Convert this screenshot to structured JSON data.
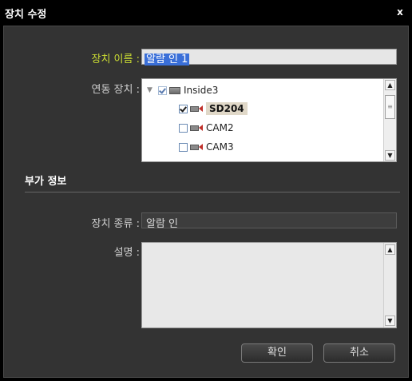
{
  "window": {
    "title": "장치 수정",
    "close_glyph": "x"
  },
  "form": {
    "device_name_label": "장치 이름 :",
    "device_name_value": "알람 인 1",
    "linked_devices_label": "연동 장치 :",
    "tree": {
      "root": {
        "label": "Inside3",
        "checked": true
      },
      "items": [
        {
          "label": "SD204",
          "checked": true,
          "selected": true
        },
        {
          "label": "CAM2",
          "checked": false
        },
        {
          "label": "CAM3",
          "checked": false
        }
      ]
    }
  },
  "extra_info": {
    "section_title": "부가 정보",
    "device_kind_label": "장치 종류 :",
    "device_kind_value": "알람 인",
    "description_label": "설명 :",
    "description_value": ""
  },
  "buttons": {
    "ok": "확인",
    "cancel": "취소"
  },
  "colors": {
    "accent_label": "#ccdd33",
    "panel_bg": "#333333"
  }
}
